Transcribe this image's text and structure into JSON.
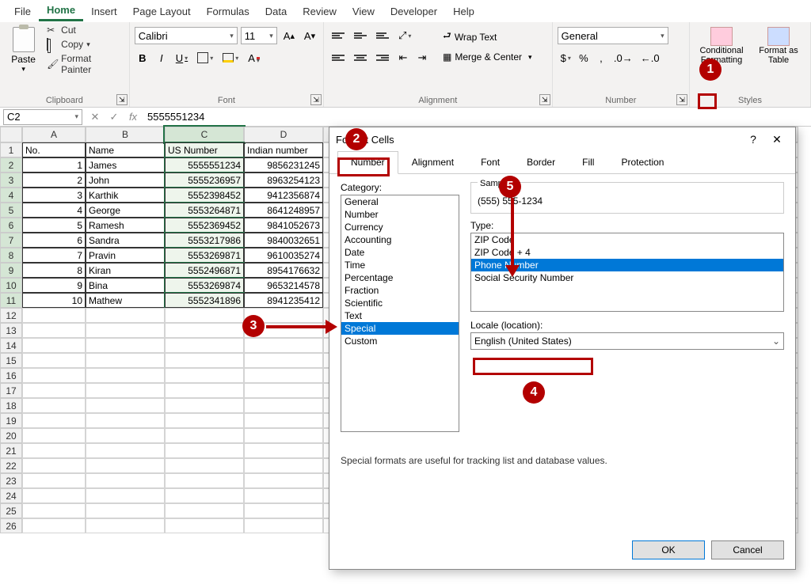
{
  "menus": [
    "File",
    "Home",
    "Insert",
    "Page Layout",
    "Formulas",
    "Data",
    "Review",
    "View",
    "Developer",
    "Help"
  ],
  "active_menu": "Home",
  "ribbon": {
    "clipboard": {
      "paste": "Paste",
      "cut": "Cut",
      "copy": "Copy",
      "painter": "Format Painter",
      "group": "Clipboard"
    },
    "font": {
      "name": "Calibri",
      "size": "11",
      "group": "Font"
    },
    "alignment": {
      "wrap": "Wrap Text",
      "merge": "Merge & Center",
      "group": "Alignment"
    },
    "number": {
      "format": "General",
      "group": "Number"
    },
    "styles": {
      "cond": "Conditional Formatting",
      "table": "Format as Table",
      "group": "Styles"
    }
  },
  "name_box": "C2",
  "formula_value": "5555551234",
  "columns": [
    "A",
    "B",
    "C",
    "D"
  ],
  "headers": [
    "No.",
    "Name",
    "US Number",
    "Indian number"
  ],
  "rows": [
    {
      "no": "1",
      "name": "James",
      "us": "5555551234",
      "in": "9856231245"
    },
    {
      "no": "2",
      "name": "John",
      "us": "5555236957",
      "in": "8963254123"
    },
    {
      "no": "3",
      "name": "Karthik",
      "us": "5552398452",
      "in": "9412356874"
    },
    {
      "no": "4",
      "name": "George",
      "us": "5553264871",
      "in": "8641248957"
    },
    {
      "no": "5",
      "name": "Ramesh",
      "us": "5552369452",
      "in": "9841052673"
    },
    {
      "no": "6",
      "name": "Sandra",
      "us": "5553217986",
      "in": "9840032651"
    },
    {
      "no": "7",
      "name": "Pravin",
      "us": "5553269871",
      "in": "9610035274"
    },
    {
      "no": "8",
      "name": "Kiran",
      "us": "5552496871",
      "in": "8954176632"
    },
    {
      "no": "9",
      "name": "Bina",
      "us": "5553269874",
      "in": "9653214578"
    },
    {
      "no": "10",
      "name": "Mathew",
      "us": "5552341896",
      "in": "8941235412"
    }
  ],
  "dialog": {
    "title": "Format Cells",
    "tabs": [
      "Number",
      "Alignment",
      "Font",
      "Border",
      "Fill",
      "Protection"
    ],
    "active_tab": "Number",
    "category_label": "Category:",
    "categories": [
      "General",
      "Number",
      "Currency",
      "Accounting",
      "Date",
      "Time",
      "Percentage",
      "Fraction",
      "Scientific",
      "Text",
      "Special",
      "Custom"
    ],
    "selected_category": "Special",
    "sample_label": "Sample",
    "sample_value": "(555) 555-1234",
    "type_label": "Type:",
    "types": [
      "ZIP Code",
      "ZIP Code + 4",
      "Phone Number",
      "Social Security Number"
    ],
    "selected_type": "Phone Number",
    "locale_label": "Locale (location):",
    "locale_value": "English (United States)",
    "hint": "Special formats are useful for tracking list and database values.",
    "ok": "OK",
    "cancel": "Cancel"
  },
  "callouts": {
    "1": "1",
    "2": "2",
    "3": "3",
    "4": "4",
    "5": "5"
  }
}
